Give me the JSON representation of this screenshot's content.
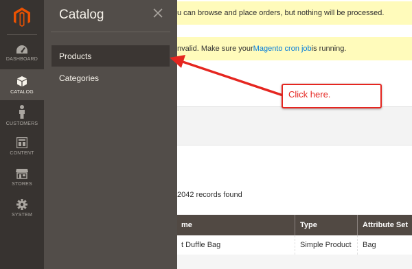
{
  "sidebar": {
    "items": [
      {
        "label": "DASHBOARD",
        "icon": "dashboard-icon"
      },
      {
        "label": "CATALOG",
        "icon": "cube-icon"
      },
      {
        "label": "CUSTOMERS",
        "icon": "person-icon"
      },
      {
        "label": "CONTENT",
        "icon": "content-icon"
      },
      {
        "label": "STORES",
        "icon": "store-icon"
      },
      {
        "label": "SYSTEM",
        "icon": "gear-icon"
      }
    ]
  },
  "flyout": {
    "title": "Catalog",
    "items": [
      {
        "label": "Products"
      },
      {
        "label": "Categories"
      }
    ]
  },
  "messages": {
    "m1": "u can browse and place orders, but nothing will be processed.",
    "m2_prefix": "nvalid. Make sure your ",
    "m2_link": "Magento cron job",
    "m2_suffix": " is running."
  },
  "grid": {
    "records": "2042 records found",
    "headers": [
      "me",
      "Type",
      "Attribute Set"
    ],
    "row": [
      "t Duffle Bag",
      "Simple Product",
      "Bag"
    ]
  },
  "annotation": {
    "callout": "Click here."
  },
  "colors": {
    "accent": "#e52620",
    "nav": "#373330",
    "flyout": "#524d49",
    "notice": "#fffbbb",
    "logo": "#eb5202"
  }
}
